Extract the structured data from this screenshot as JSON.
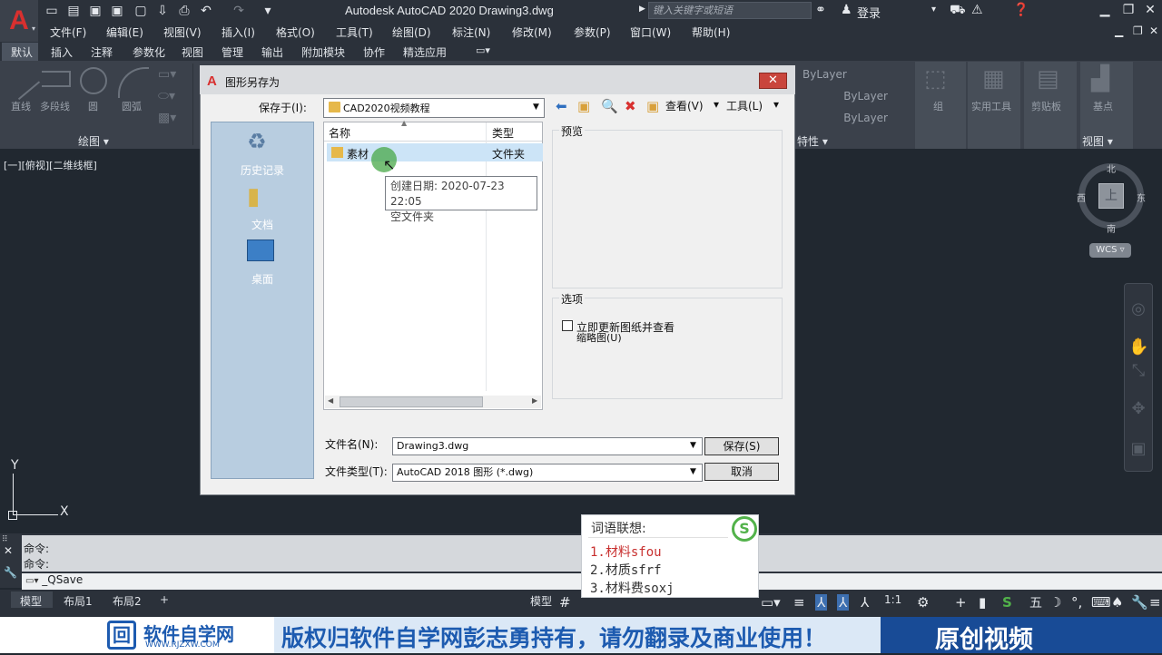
{
  "app": {
    "title": "Autodesk AutoCAD 2020    Drawing3.dwg",
    "search_placeholder": "键入关键字或短语",
    "login": "登录"
  },
  "menu": [
    "文件(F)",
    "编辑(E)",
    "视图(V)",
    "插入(I)",
    "格式(O)",
    "工具(T)",
    "绘图(D)",
    "标注(N)",
    "修改(M)",
    "参数(P)",
    "窗口(W)",
    "帮助(H)"
  ],
  "ribbon_tabs": [
    "默认",
    "插入",
    "注释",
    "参数化",
    "视图",
    "管理",
    "输出",
    "附加模块",
    "协作",
    "精选应用"
  ],
  "ribbon": {
    "draw_tools": [
      "直线",
      "多段线",
      "圆",
      "圆弧"
    ],
    "draw_group": "绘图 ▾",
    "bylayer": [
      "ByLayer",
      "ByLayer",
      "ByLayer"
    ],
    "props_group": "特性 ▾",
    "right_tools": [
      "组",
      "实用工具",
      "剪贴板",
      "基点"
    ],
    "view_group": "视图 ▾"
  },
  "viewport": {
    "label": "[一][俯视][二维线框]",
    "compass": {
      "n": "北",
      "s": "南",
      "e": "东",
      "w": "西"
    },
    "cube_face": "上",
    "wcs": "WCS ▿",
    "ucs": {
      "y": "Y",
      "x": "X"
    }
  },
  "dialog": {
    "title": "图形另存为",
    "save_in_label": "保存于(I):",
    "save_in_value": "CAD2020视频教程",
    "toolbar": {
      "view": "查看(V)",
      "tools": "工具(L)"
    },
    "places": [
      "历史记录",
      "文档",
      "桌面"
    ],
    "columns": {
      "name": "名称",
      "type": "类型"
    },
    "rows": [
      {
        "name": "素材",
        "type": "文件夹"
      }
    ],
    "tooltip": {
      "line1": "创建日期: 2020-07-23 22:05",
      "line2": "空文件夹"
    },
    "preview_label": "预览",
    "options_label": "选项",
    "checkbox_label1": "立即更新图纸并查看",
    "checkbox_label2": "缩略图(U)",
    "filename_label": "文件名(N):",
    "filename_value": "Drawing3.dwg",
    "filetype_label": "文件类型(T):",
    "filetype_value": "AutoCAD 2018 图形 (*.dwg)",
    "save_button": "保存(S)",
    "cancel_button": "取消"
  },
  "command": {
    "history": [
      "命令:",
      "命令:"
    ],
    "current": "_QSave"
  },
  "status": {
    "layout_tabs": [
      "模型",
      "布局1",
      "布局2"
    ],
    "add_tab": "+",
    "model_button": "模型",
    "scale": "1:1",
    "ime_mode": "五"
  },
  "ime": {
    "title": "词语联想:",
    "candidates": [
      "1.材料sfou",
      "2.材质sfrf",
      "3.材料费soxj"
    ],
    "logo": "S"
  },
  "footer": {
    "brand": "软件自学网",
    "url": "WWW.RJZXW.COM",
    "copyright": "版权归软件自学网彭志勇持有，请勿翻录及商业使用！",
    "original": "原创视频"
  },
  "colors": {
    "accent_red": "#d8302f",
    "dark_bg": "#212830",
    "footer_blue": "#184b96"
  }
}
